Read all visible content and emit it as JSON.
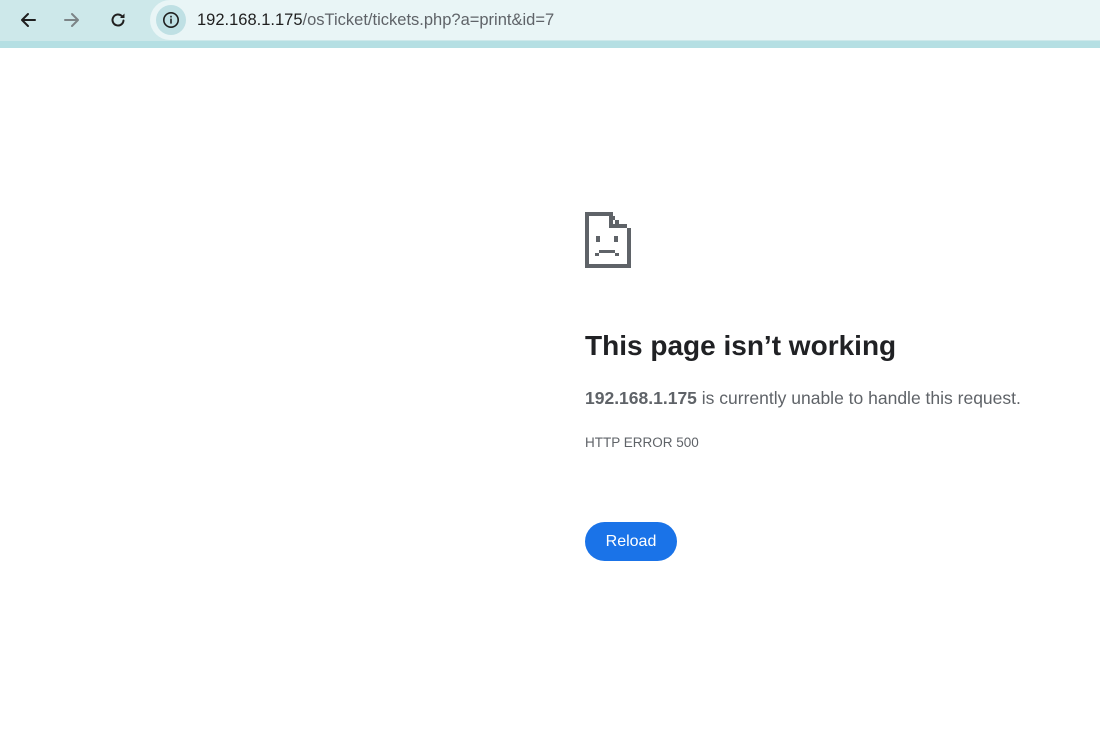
{
  "browser": {
    "address": {
      "host": "192.168.1.175",
      "path": "/osTicket/tickets.php?a=print&id=7"
    },
    "icons": {
      "back": "back-arrow-icon",
      "forward": "forward-arrow-icon",
      "reload": "reload-icon",
      "site_info": "info-icon"
    },
    "colors": {
      "toolbar": "#cde8ea",
      "omnibox": "#e9f5f6"
    }
  },
  "error_page": {
    "icon": "sad-page-icon",
    "title": "This page isn’t working",
    "message_host": "192.168.1.175",
    "message_rest": " is currently unable to handle this request.",
    "error_code": "HTTP ERROR 500",
    "reload_label": "Reload",
    "colors": {
      "button": "#1a73e8"
    }
  }
}
